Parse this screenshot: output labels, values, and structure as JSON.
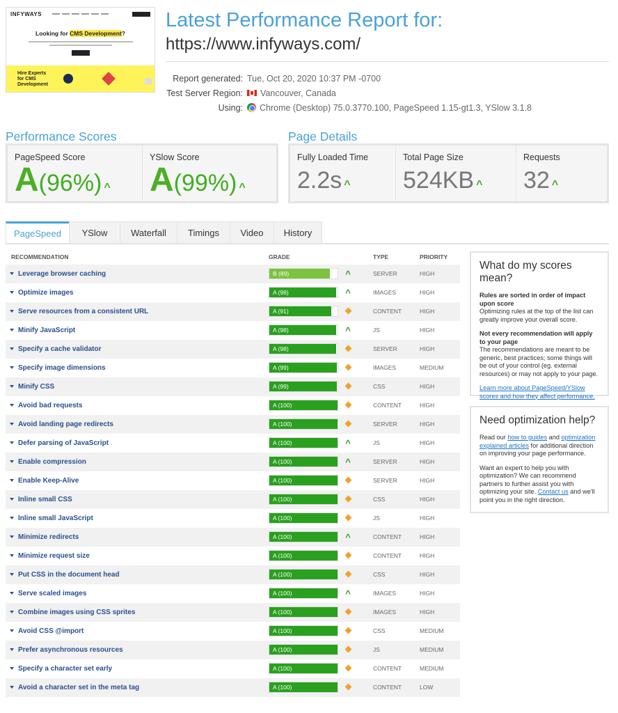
{
  "thumbnail": {
    "logo": "INFYWAYS",
    "heading_prefix": "Looking for ",
    "heading_highlight": "CMS Development",
    "heading_suffix": "?",
    "hire_text": "Hire Experts for CMS Development"
  },
  "header": {
    "title": "Latest Performance Report for:",
    "url": "https://www.infyways.com/"
  },
  "meta": {
    "report_generated_label": "Report generated:",
    "report_generated_value": "Tue, Oct 20, 2020 10:37 PM -0700",
    "region_label": "Test Server Region:",
    "region_value": "Vancouver, Canada",
    "using_label": "Using:",
    "using_value": "Chrome (Desktop) 75.0.3770.100, PageSpeed 1.15-gt1.3, YSlow 3.1.8"
  },
  "scores": {
    "title": "Performance Scores",
    "pagespeed_label": "PageSpeed Score",
    "pagespeed_grade": "A",
    "pagespeed_pct": "(96%)",
    "yslow_label": "YSlow Score",
    "yslow_grade": "A",
    "yslow_pct": "(99%)"
  },
  "details": {
    "title": "Page Details",
    "loaded_label": "Fully Loaded Time",
    "loaded_value": "2.2s",
    "size_label": "Total Page Size",
    "size_value": "524KB",
    "requests_label": "Requests",
    "requests_value": "32"
  },
  "tabs": [
    "PageSpeed",
    "YSlow",
    "Waterfall",
    "Timings",
    "Video",
    "History"
  ],
  "table": {
    "headers": {
      "recommendation": "RECOMMENDATION",
      "grade": "GRADE",
      "type": "TYPE",
      "priority": "PRIORITY"
    },
    "rows": [
      {
        "rec": "Leverage browser caching",
        "grade": "B (89)",
        "score": 89,
        "trend": "up",
        "type": "SERVER",
        "priority": "HIGH"
      },
      {
        "rec": "Optimize images",
        "grade": "A (98)",
        "score": 98,
        "trend": "up",
        "type": "IMAGES",
        "priority": "HIGH"
      },
      {
        "rec": "Serve resources from a consistent URL",
        "grade": "A (91)",
        "score": 91,
        "trend": "diamond",
        "type": "CONTENT",
        "priority": "HIGH"
      },
      {
        "rec": "Minify JavaScript",
        "grade": "A (98)",
        "score": 98,
        "trend": "up",
        "type": "JS",
        "priority": "HIGH"
      },
      {
        "rec": "Specify a cache validator",
        "grade": "A (98)",
        "score": 98,
        "trend": "diamond",
        "type": "SERVER",
        "priority": "HIGH"
      },
      {
        "rec": "Specify image dimensions",
        "grade": "A (99)",
        "score": 99,
        "trend": "diamond",
        "type": "IMAGES",
        "priority": "MEDIUM"
      },
      {
        "rec": "Minify CSS",
        "grade": "A (99)",
        "score": 99,
        "trend": "diamond",
        "type": "CSS",
        "priority": "HIGH"
      },
      {
        "rec": "Avoid bad requests",
        "grade": "A (100)",
        "score": 100,
        "trend": "diamond",
        "type": "CONTENT",
        "priority": "HIGH"
      },
      {
        "rec": "Avoid landing page redirects",
        "grade": "A (100)",
        "score": 100,
        "trend": "diamond",
        "type": "SERVER",
        "priority": "HIGH"
      },
      {
        "rec": "Defer parsing of JavaScript",
        "grade": "A (100)",
        "score": 100,
        "trend": "up",
        "type": "JS",
        "priority": "HIGH"
      },
      {
        "rec": "Enable compression",
        "grade": "A (100)",
        "score": 100,
        "trend": "up",
        "type": "SERVER",
        "priority": "HIGH"
      },
      {
        "rec": "Enable Keep-Alive",
        "grade": "A (100)",
        "score": 100,
        "trend": "diamond",
        "type": "SERVER",
        "priority": "HIGH"
      },
      {
        "rec": "Inline small CSS",
        "grade": "A (100)",
        "score": 100,
        "trend": "diamond",
        "type": "CSS",
        "priority": "HIGH"
      },
      {
        "rec": "Inline small JavaScript",
        "grade": "A (100)",
        "score": 100,
        "trend": "diamond",
        "type": "JS",
        "priority": "HIGH"
      },
      {
        "rec": "Minimize redirects",
        "grade": "A (100)",
        "score": 100,
        "trend": "up",
        "type": "CONTENT",
        "priority": "HIGH"
      },
      {
        "rec": "Minimize request size",
        "grade": "A (100)",
        "score": 100,
        "trend": "diamond",
        "type": "CONTENT",
        "priority": "HIGH"
      },
      {
        "rec": "Put CSS in the document head",
        "grade": "A (100)",
        "score": 100,
        "trend": "diamond",
        "type": "CSS",
        "priority": "HIGH"
      },
      {
        "rec": "Serve scaled images",
        "grade": "A (100)",
        "score": 100,
        "trend": "up",
        "type": "IMAGES",
        "priority": "HIGH"
      },
      {
        "rec": "Combine images using CSS sprites",
        "grade": "A (100)",
        "score": 100,
        "trend": "diamond",
        "type": "IMAGES",
        "priority": "HIGH"
      },
      {
        "rec": "Avoid CSS @import",
        "grade": "A (100)",
        "score": 100,
        "trend": "diamond",
        "type": "CSS",
        "priority": "MEDIUM"
      },
      {
        "rec": "Prefer asynchronous resources",
        "grade": "A (100)",
        "score": 100,
        "trend": "diamond",
        "type": "JS",
        "priority": "MEDIUM"
      },
      {
        "rec": "Specify a character set early",
        "grade": "A (100)",
        "score": 100,
        "trend": "diamond",
        "type": "CONTENT",
        "priority": "MEDIUM"
      },
      {
        "rec": "Avoid a character set in the meta tag",
        "grade": "A (100)",
        "score": 100,
        "trend": "diamond",
        "type": "CONTENT",
        "priority": "LOW"
      }
    ]
  },
  "side_scores": {
    "title": "What do my scores mean?",
    "p1_bold": "Rules are sorted in order of impact upon score",
    "p1_text": "Optimizing rules at the top of the list can greatly improve your overall score.",
    "p2_bold": "Not every recommendation will apply to your page",
    "p2_text": "The recommendations are meant to be generic, best practices; some things will be out of your control (eg. external resources) or may not apply to your page.",
    "link": "Learn more about PageSpeed/YSlow scores and how they affect performance."
  },
  "side_help": {
    "title": "Need optimization help?",
    "p1_a": "Read our ",
    "p1_link1": "how to guides",
    "p1_b": " and ",
    "p1_link2": "optimization explained articles",
    "p1_c": " for additional direction on improving your page performance.",
    "p2_a": "Want an expert to help you with optimization? We can recommend partners to further assist you with optimizing your site. ",
    "p2_link": "Contact us",
    "p2_b": " and we'll point you in the right direction."
  }
}
